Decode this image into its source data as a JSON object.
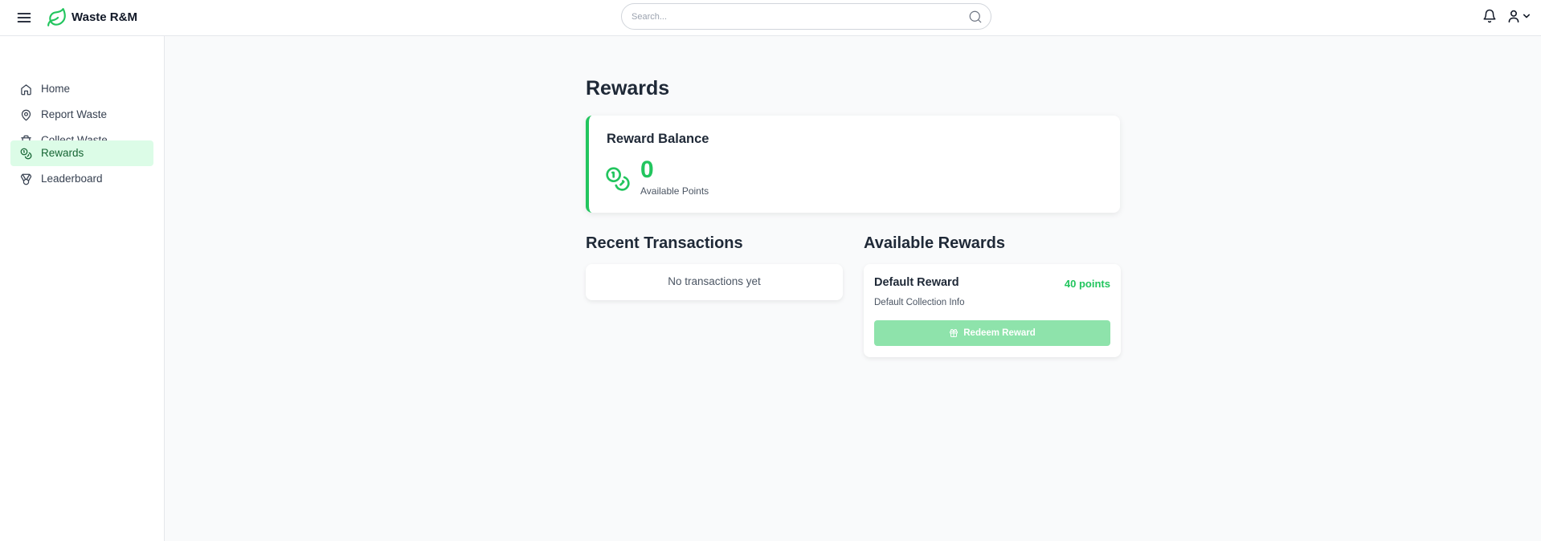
{
  "app": {
    "brand": "Waste R&M"
  },
  "header": {
    "search_placeholder": "Search...",
    "icons": [
      "menu-icon",
      "leaf-icon",
      "search-icon",
      "bell-icon",
      "user-icon",
      "chevron-down-icon"
    ]
  },
  "sidebar": {
    "items": [
      {
        "label": "Home",
        "icon": "home-icon",
        "active": false
      },
      {
        "label": "Report Waste",
        "icon": "map-pin-icon",
        "active": false
      },
      {
        "label": "Collect Waste",
        "icon": "trash-icon",
        "active": false
      },
      {
        "label": "Rewards",
        "icon": "coins-icon",
        "active": true
      },
      {
        "label": "Leaderboard",
        "icon": "medal-icon",
        "active": false
      }
    ]
  },
  "main": {
    "title": "Rewards",
    "balance": {
      "title": "Reward Balance",
      "value": "0",
      "label": "Available Points"
    },
    "transactions": {
      "title": "Recent Transactions",
      "empty_text": "No transactions yet"
    },
    "available_rewards": {
      "title": "Available Rewards",
      "items": [
        {
          "name": "Default Reward",
          "points": "40 points",
          "description": "Default Collection Info",
          "button_label": "Redeem Reward"
        }
      ]
    }
  },
  "colors": {
    "accent": "#22c55e",
    "active_bg": "#dcfce7",
    "button_disabled": "#8ee3ab"
  }
}
